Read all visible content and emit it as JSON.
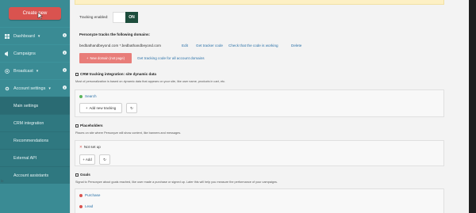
{
  "sidebar": {
    "create_button": "Create new",
    "items": [
      {
        "label": "Dashboard",
        "icon": "dashboard-icon",
        "chevron": "▾",
        "badge": "i"
      },
      {
        "label": "Campaigns",
        "icon": "campaigns-icon",
        "chevron": "",
        "badge": "i"
      },
      {
        "label": "Broadcast",
        "icon": "broadcast-icon",
        "chevron": "▾",
        "badge": "i"
      },
      {
        "label": "Account settings",
        "icon": "settings-icon",
        "chevron": "▾",
        "badge": "i"
      }
    ],
    "sub_items": [
      "Main settings",
      "CRM integration",
      "Recommendations",
      "External API",
      "Account assistants"
    ],
    "stub": "le"
  },
  "tracking": {
    "label": "Tracking enabled:",
    "on_label": "ON"
  },
  "domains": {
    "heading": "Personyze tracks the following domains:",
    "value": "bedbathandbeyond.com *.bedbathandbeyond.com",
    "actions": [
      "Edit",
      "Get tracker code",
      "Check that the code is working",
      "Delete"
    ],
    "new_domain_button": "New domain (not page)",
    "all_code_link": "Get tracking code for all account domains"
  },
  "crm": {
    "title": "CRM tracking integration: site dynamic data",
    "description": "Most of personalization is based on dynamic data that appears on your site, like user name, products in cart, etc.",
    "item": "Search",
    "add_button": "Add new tracking"
  },
  "placeholders": {
    "title": "Placeholders",
    "description": "Places on site where Personyze will show content, like banners and messages.",
    "status": "Not set up",
    "add_button": "Add"
  },
  "goals": {
    "title": "Goals",
    "description": "Signal to Personyze about goals reached, like user made a purchase or signed up. Later this will help you measure the performance of your campaigns.",
    "items": [
      "Purchase",
      "Lead"
    ]
  },
  "colors": {
    "sidebar": "#3a8b94",
    "sidebar_sub": "#2f7880",
    "accent_red": "#d9534f",
    "toggle_on": "#1d4d3c",
    "link": "#2a71a8"
  }
}
